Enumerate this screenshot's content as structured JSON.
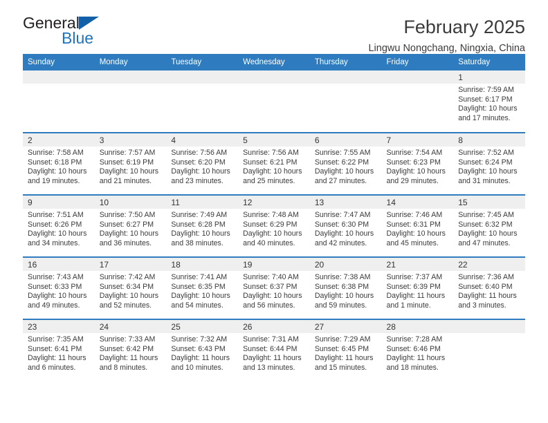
{
  "brand": {
    "name_part1": "General",
    "name_part2": "Blue",
    "triangle_icon": "blue-triangle-logo-mark",
    "accent_color": "#1e73be"
  },
  "header": {
    "title": "February 2025",
    "location": "Lingwu Nongchang, Ningxia, China"
  },
  "calendar": {
    "header_color": "#2e7bbf",
    "daynum_band_color": "#efefef",
    "weekday_headers": [
      "Sunday",
      "Monday",
      "Tuesday",
      "Wednesday",
      "Thursday",
      "Friday",
      "Saturday"
    ],
    "labels": {
      "sunrise": "Sunrise:",
      "sunset": "Sunset:",
      "daylight": "Daylight:"
    },
    "weeks": [
      [
        {
          "empty": true
        },
        {
          "empty": true
        },
        {
          "empty": true
        },
        {
          "empty": true
        },
        {
          "empty": true
        },
        {
          "empty": true
        },
        {
          "day": "1",
          "sunrise": "Sunrise: 7:59 AM",
          "sunset": "Sunset: 6:17 PM",
          "daylight": "Daylight: 10 hours and 17 minutes."
        }
      ],
      [
        {
          "day": "2",
          "sunrise": "Sunrise: 7:58 AM",
          "sunset": "Sunset: 6:18 PM",
          "daylight": "Daylight: 10 hours and 19 minutes."
        },
        {
          "day": "3",
          "sunrise": "Sunrise: 7:57 AM",
          "sunset": "Sunset: 6:19 PM",
          "daylight": "Daylight: 10 hours and 21 minutes."
        },
        {
          "day": "4",
          "sunrise": "Sunrise: 7:56 AM",
          "sunset": "Sunset: 6:20 PM",
          "daylight": "Daylight: 10 hours and 23 minutes."
        },
        {
          "day": "5",
          "sunrise": "Sunrise: 7:56 AM",
          "sunset": "Sunset: 6:21 PM",
          "daylight": "Daylight: 10 hours and 25 minutes."
        },
        {
          "day": "6",
          "sunrise": "Sunrise: 7:55 AM",
          "sunset": "Sunset: 6:22 PM",
          "daylight": "Daylight: 10 hours and 27 minutes."
        },
        {
          "day": "7",
          "sunrise": "Sunrise: 7:54 AM",
          "sunset": "Sunset: 6:23 PM",
          "daylight": "Daylight: 10 hours and 29 minutes."
        },
        {
          "day": "8",
          "sunrise": "Sunrise: 7:52 AM",
          "sunset": "Sunset: 6:24 PM",
          "daylight": "Daylight: 10 hours and 31 minutes."
        }
      ],
      [
        {
          "day": "9",
          "sunrise": "Sunrise: 7:51 AM",
          "sunset": "Sunset: 6:26 PM",
          "daylight": "Daylight: 10 hours and 34 minutes."
        },
        {
          "day": "10",
          "sunrise": "Sunrise: 7:50 AM",
          "sunset": "Sunset: 6:27 PM",
          "daylight": "Daylight: 10 hours and 36 minutes."
        },
        {
          "day": "11",
          "sunrise": "Sunrise: 7:49 AM",
          "sunset": "Sunset: 6:28 PM",
          "daylight": "Daylight: 10 hours and 38 minutes."
        },
        {
          "day": "12",
          "sunrise": "Sunrise: 7:48 AM",
          "sunset": "Sunset: 6:29 PM",
          "daylight": "Daylight: 10 hours and 40 minutes."
        },
        {
          "day": "13",
          "sunrise": "Sunrise: 7:47 AM",
          "sunset": "Sunset: 6:30 PM",
          "daylight": "Daylight: 10 hours and 42 minutes."
        },
        {
          "day": "14",
          "sunrise": "Sunrise: 7:46 AM",
          "sunset": "Sunset: 6:31 PM",
          "daylight": "Daylight: 10 hours and 45 minutes."
        },
        {
          "day": "15",
          "sunrise": "Sunrise: 7:45 AM",
          "sunset": "Sunset: 6:32 PM",
          "daylight": "Daylight: 10 hours and 47 minutes."
        }
      ],
      [
        {
          "day": "16",
          "sunrise": "Sunrise: 7:43 AM",
          "sunset": "Sunset: 6:33 PM",
          "daylight": "Daylight: 10 hours and 49 minutes."
        },
        {
          "day": "17",
          "sunrise": "Sunrise: 7:42 AM",
          "sunset": "Sunset: 6:34 PM",
          "daylight": "Daylight: 10 hours and 52 minutes."
        },
        {
          "day": "18",
          "sunrise": "Sunrise: 7:41 AM",
          "sunset": "Sunset: 6:35 PM",
          "daylight": "Daylight: 10 hours and 54 minutes."
        },
        {
          "day": "19",
          "sunrise": "Sunrise: 7:40 AM",
          "sunset": "Sunset: 6:37 PM",
          "daylight": "Daylight: 10 hours and 56 minutes."
        },
        {
          "day": "20",
          "sunrise": "Sunrise: 7:38 AM",
          "sunset": "Sunset: 6:38 PM",
          "daylight": "Daylight: 10 hours and 59 minutes."
        },
        {
          "day": "21",
          "sunrise": "Sunrise: 7:37 AM",
          "sunset": "Sunset: 6:39 PM",
          "daylight": "Daylight: 11 hours and 1 minute."
        },
        {
          "day": "22",
          "sunrise": "Sunrise: 7:36 AM",
          "sunset": "Sunset: 6:40 PM",
          "daylight": "Daylight: 11 hours and 3 minutes."
        }
      ],
      [
        {
          "day": "23",
          "sunrise": "Sunrise: 7:35 AM",
          "sunset": "Sunset: 6:41 PM",
          "daylight": "Daylight: 11 hours and 6 minutes."
        },
        {
          "day": "24",
          "sunrise": "Sunrise: 7:33 AM",
          "sunset": "Sunset: 6:42 PM",
          "daylight": "Daylight: 11 hours and 8 minutes."
        },
        {
          "day": "25",
          "sunrise": "Sunrise: 7:32 AM",
          "sunset": "Sunset: 6:43 PM",
          "daylight": "Daylight: 11 hours and 10 minutes."
        },
        {
          "day": "26",
          "sunrise": "Sunrise: 7:31 AM",
          "sunset": "Sunset: 6:44 PM",
          "daylight": "Daylight: 11 hours and 13 minutes."
        },
        {
          "day": "27",
          "sunrise": "Sunrise: 7:29 AM",
          "sunset": "Sunset: 6:45 PM",
          "daylight": "Daylight: 11 hours and 15 minutes."
        },
        {
          "day": "28",
          "sunrise": "Sunrise: 7:28 AM",
          "sunset": "Sunset: 6:46 PM",
          "daylight": "Daylight: 11 hours and 18 minutes."
        },
        {
          "empty": true
        }
      ]
    ]
  }
}
